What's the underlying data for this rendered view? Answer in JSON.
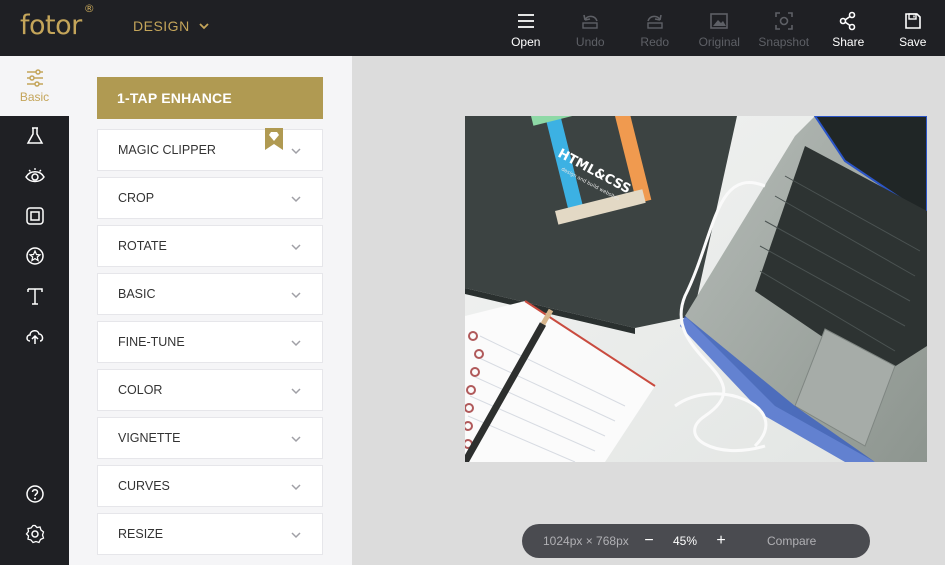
{
  "app": {
    "logo_text": "fotor",
    "logo_mark": "®",
    "mode_label": "DESIGN"
  },
  "toolbar": {
    "items": [
      {
        "label": "Open",
        "icon": "menu-icon",
        "enabled": true
      },
      {
        "label": "Undo",
        "icon": "undo-icon",
        "enabled": false
      },
      {
        "label": "Redo",
        "icon": "redo-icon",
        "enabled": false
      },
      {
        "label": "Original",
        "icon": "image-icon",
        "enabled": false
      },
      {
        "label": "Snapshot",
        "icon": "snapshot-icon",
        "enabled": false
      },
      {
        "label": "Share",
        "icon": "share-icon",
        "enabled": true
      },
      {
        "label": "Save",
        "icon": "save-icon",
        "enabled": true
      }
    ]
  },
  "leftnav": {
    "active_label": "Basic",
    "items": [
      "sliders-icon",
      "flask-icon",
      "eye-icon",
      "frame-icon",
      "star-badge-icon",
      "text-icon",
      "cloud-upload-icon",
      "help-icon",
      "settings-icon"
    ]
  },
  "panel": {
    "enhance_label": "1-TAP ENHANCE",
    "items": [
      {
        "label": "MAGIC CLIPPER",
        "premium": true
      },
      {
        "label": "CROP"
      },
      {
        "label": "ROTATE"
      },
      {
        "label": "BASIC"
      },
      {
        "label": "FINE-TUNE"
      },
      {
        "label": "COLOR"
      },
      {
        "label": "VIGNETTE"
      },
      {
        "label": "CURVES"
      },
      {
        "label": "RESIZE"
      }
    ]
  },
  "status": {
    "dimensions": "1024px × 768px",
    "zoom_out": "−",
    "zoom": "45%",
    "zoom_in": "+",
    "compare": "Compare"
  },
  "photo": {
    "book_title": "HTML&CSS",
    "book_subtitle": "design and build websites"
  },
  "colors": {
    "accent": "#c4a55a",
    "accent_button": "#b09a52",
    "dark": "#1f2024",
    "panel": "#f5f5f7"
  }
}
